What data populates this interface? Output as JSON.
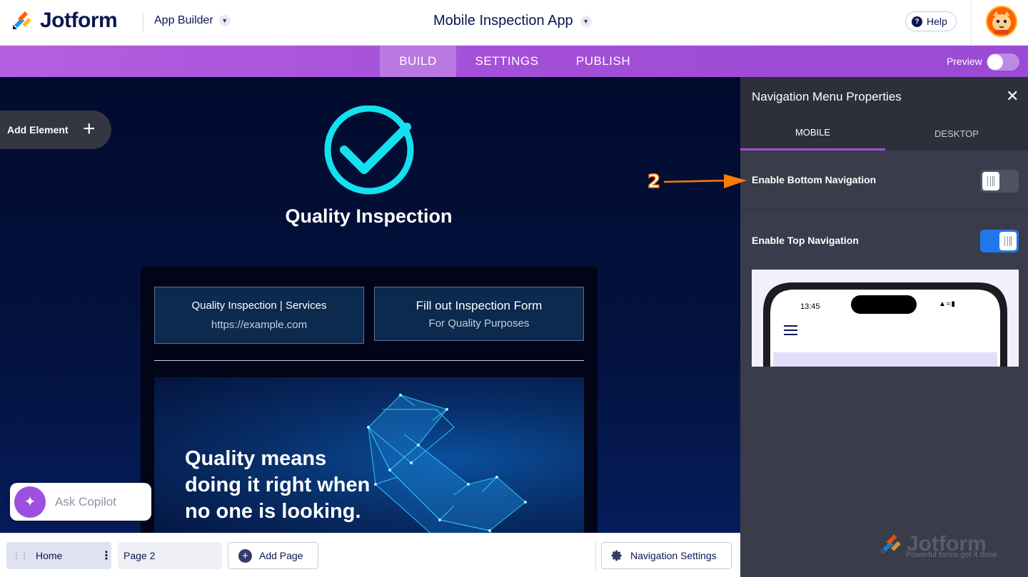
{
  "header": {
    "brand": "Jotform",
    "app_builder_label": "App Builder",
    "app_title": "Mobile Inspection App",
    "help_label": "Help"
  },
  "nav": {
    "tabs": [
      {
        "label": "BUILD",
        "active": true
      },
      {
        "label": "SETTINGS",
        "active": false
      },
      {
        "label": "PUBLISH",
        "active": false
      }
    ],
    "preview_label": "Preview",
    "preview_on": false
  },
  "canvas": {
    "add_element_label": "Add Element",
    "title": "Quality Inspection",
    "buttons": [
      {
        "title": "Quality Inspection | Services",
        "subtitle": "https://example.com"
      },
      {
        "title": "Fill out Inspection Form",
        "subtitle": "For Quality Purposes"
      }
    ],
    "banner_lines": [
      "Quality means",
      "doing it right when",
      "no one is looking."
    ],
    "copilot_label": "Ask Copilot"
  },
  "pages": {
    "items": [
      "Home",
      "Page 2"
    ],
    "add_page_label": "Add Page",
    "nav_settings_label": "Navigation Settings"
  },
  "panel": {
    "title": "Navigation Menu Properties",
    "tabs": [
      {
        "label": "MOBILE",
        "active": true
      },
      {
        "label": "DESKTOP",
        "active": false
      }
    ],
    "bottom_nav_label": "Enable Bottom Navigation",
    "bottom_nav_on": false,
    "top_nav_label": "Enable Top Navigation",
    "top_nav_on": true,
    "phone_time": "13:45",
    "footer_brand": "Jotform",
    "footer_tagline": "Powerful forms get it done"
  },
  "annotation": {
    "step_number": "2",
    "color": "#ff7a00"
  },
  "colors": {
    "accent": "#a34fd8",
    "brand_navy": "#0a1551",
    "toggle_on": "#2176e8",
    "check_cyan": "#14e0f0"
  }
}
